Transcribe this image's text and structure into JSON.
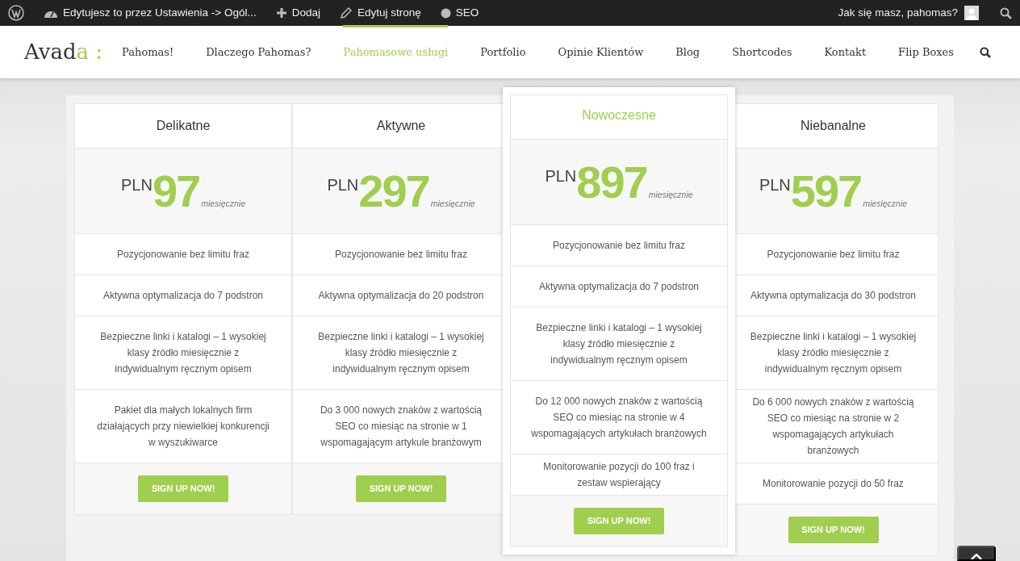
{
  "admin_bar": {
    "items": [
      {
        "kind": "wp"
      },
      {
        "kind": "dashboard",
        "label": "Edytujesz to przez Ustawienia -> Ogól..."
      },
      {
        "kind": "plus",
        "label": "Dodaj"
      },
      {
        "kind": "pencil",
        "label": "Edytuj stronę"
      },
      {
        "kind": "dot",
        "label": "SEO"
      }
    ],
    "greeting": "Jak się masz, pahomas?"
  },
  "header": {
    "logo_main": "Avad",
    "logo_accent": "a :",
    "nav": [
      {
        "label": "Pahomas!",
        "selected": false
      },
      {
        "label": "Dlaczego Pahomas?",
        "selected": false
      },
      {
        "label": "Pahomasowe usługi",
        "selected": true
      },
      {
        "label": "Portfolio",
        "selected": false
      },
      {
        "label": "Opinie Klientów",
        "selected": false
      },
      {
        "label": "Blog",
        "selected": false
      },
      {
        "label": "Shortcodes",
        "selected": false
      },
      {
        "label": "Kontakt",
        "selected": false
      },
      {
        "label": "Flip Boxes",
        "selected": false
      }
    ]
  },
  "plans": [
    {
      "title": "Delikatne",
      "featured": false,
      "currency": "PLN",
      "amount": "97",
      "period": "miesięcznie",
      "features": [
        "Pozycjonowanie bez limitu fraz",
        "Aktywna optymalizacja do 7 podstron",
        "Bezpieczne linki i katalogi – 1 wysokiej klasy źródło miesięcznie z indywidualnym ręcznym opisem",
        "Pakiet dla małych lokalnych firm działających przy niewielkiej konkurencji w wyszukiwarce"
      ],
      "button": "SIGN UP NOW!"
    },
    {
      "title": "Aktywne",
      "featured": false,
      "currency": "PLN",
      "amount": "297",
      "period": "miesięcznie",
      "features": [
        "Pozycjonowanie bez limitu fraz",
        "Aktywna optymalizacja do 20 podstron",
        "Bezpieczne linki i katalogi – 1 wysokiej klasy źródło miesięcznie z indywidualnym ręcznym opisem",
        "Do 3 000 nowych znaków z wartością SEO co miesiąc na stronie w 1 wspomagającym artykule branżowym"
      ],
      "button": "SIGN UP NOW!"
    },
    {
      "title": "Nowoczesne",
      "featured": true,
      "currency": "PLN",
      "amount": "897",
      "period": "miesięcznie",
      "features": [
        "Pozycjonowanie bez limitu fraz",
        "Aktywna optymalizacja do 7 podstron",
        "Bezpieczne linki i katalogi – 1 wysokiej klasy źródło miesięcznie z indywidualnym ręcznym opisem",
        "Do 12 000 nowych znaków z wartością SEO co miesiąc na stronie w 4 wspomagających artykułach branżowych",
        "Monitorowanie pozycji do 100 fraz i zestaw wspierający"
      ],
      "button": "SIGN UP NOW!"
    },
    {
      "title": "Niebanalne",
      "featured": false,
      "currency": "PLN",
      "amount": "597",
      "period": "miesięcznie",
      "features": [
        "Pozycjonowanie bez limitu fraz",
        "Aktywna optymalizacja do 30 podstron",
        "Bezpieczne linki i katalogi – 1 wysokiej klasy źródło miesięcznie z indywidualnym ręcznym opisem",
        "Do 6 000 nowych znaków z wartością SEO co miesiąc na stronie w 2 wspomagających artykułach branżowych",
        "Monitorowanie pozycji do 50 fraz"
      ],
      "button": "SIGN UP NOW!"
    }
  ]
}
